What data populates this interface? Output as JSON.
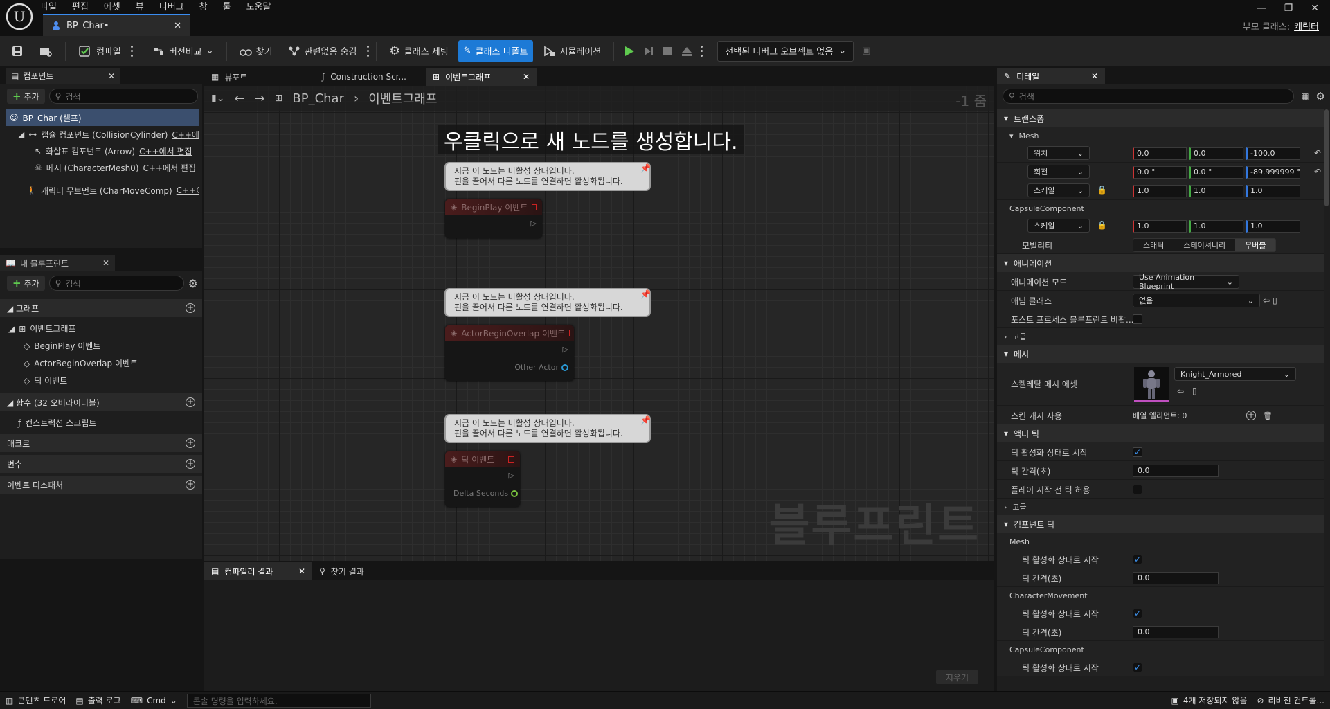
{
  "app": {
    "doc_tab": "BP_Char•",
    "parent_class_label": "부모 클래스:",
    "parent_class_value": "캐릭터"
  },
  "menu": [
    "파일",
    "편집",
    "에셋",
    "뷰",
    "디버그",
    "창",
    "툴",
    "도움말"
  ],
  "toolbar": {
    "compile": "컴파일",
    "diff": "버전비교",
    "find": "찾기",
    "hide_unrelated": "관련없음 숨김",
    "class_settings": "클래스 세팅",
    "class_defaults": "클래스 디폴트",
    "simulation": "시뮬레이션",
    "debug_object": "선택된 디버그 오브젝트 없음"
  },
  "components": {
    "title": "컴포넌트",
    "add": "추가",
    "search_placeholder": "검색",
    "items": [
      {
        "label": "BP_Char (셀프)",
        "cpp": ""
      },
      {
        "label": "캡슐 컴포넌트 (CollisionCylinder)",
        "cpp": "C++에..."
      },
      {
        "label": "화살표 컴포넌트 (Arrow)",
        "cpp": "C++에서 편집"
      },
      {
        "label": "메시 (CharacterMesh0)",
        "cpp": "C++에서 편집"
      },
      {
        "label": "캐릭터 무브먼트 (CharMoveComp)",
        "cpp": "C++C"
      }
    ]
  },
  "my_blueprint": {
    "title": "내 블루프린트",
    "add": "추가",
    "search_placeholder": "검색",
    "graph_section": "그래프",
    "event_graph": "이벤트그래프",
    "events": [
      "BeginPlay 이벤트",
      "ActorBeginOverlap 이벤트",
      "틱 이벤트"
    ],
    "functions_section": "함수 (32 오버라이더블)",
    "construction_script": "컨스트럭션 스크립트",
    "macros": "매크로",
    "variables": "변수",
    "dispatchers": "이벤트 디스패처"
  },
  "graph": {
    "tabs": [
      "뷰포트",
      "Construction Scr...",
      "이벤트그래프"
    ],
    "breadcrumb_root": "BP_Char",
    "breadcrumb_current": "이벤트그래프",
    "zoom": "-1 줌",
    "hint": "우클릭으로 새 노드를 생성합니다.",
    "watermark": "블루프린트",
    "note_line1": "지금 이 노드는 비활성 상태입니다.",
    "note_line2": "핀을 끌어서 다른 노드를 연결하면 활성화됩니다.",
    "nodes": [
      {
        "title": "BeginPlay 이벤트",
        "pin": ""
      },
      {
        "title": "ActorBeginOverlap 이벤트",
        "pin": "Other Actor"
      },
      {
        "title": "틱 이벤트",
        "pin": "Delta Seconds"
      }
    ]
  },
  "output": {
    "compiler_results": "컴파일러 결과",
    "find_results": "찾기 결과",
    "clear": "지우기"
  },
  "details": {
    "title": "디테일",
    "search_placeholder": "검색",
    "transform": "트랜스폼",
    "mesh_sub": "Mesh",
    "location": "위치",
    "rotation": "회전",
    "scale": "스케일",
    "loc": [
      "0.0",
      "0.0",
      "-100.0"
    ],
    "rot": [
      "0.0 °",
      "0.0 °",
      "-89.999999 °"
    ],
    "scl": [
      "1.0",
      "1.0",
      "1.0"
    ],
    "capsule_sub": "CapsuleComponent",
    "capsule_scl": [
      "1.0",
      "1.0",
      "1.0"
    ],
    "mobility": "모빌리티",
    "mobility_opts": [
      "스태틱",
      "스테이셔너리",
      "무버블"
    ],
    "animation": "애니메이션",
    "anim_mode": "애니메이션 모드",
    "anim_mode_val": "Use Animation Blueprint",
    "anim_class": "애님 클래스",
    "anim_class_val": "없음",
    "post_process": "포스트 프로세스 블루프린트 비활...",
    "advanced": "고급",
    "mesh_section": "메시",
    "skeletal_mesh": "스켈레탈 메시 에셋",
    "skeletal_mesh_val": "Knight_Armored",
    "skin_cache": "스킨 캐시 사용",
    "array_elements": "배열 엘리먼트: 0",
    "actor_tick": "액터 틱",
    "tick_start": "틱 활성화 상태로 시작",
    "tick_interval": "틱 간격(초)",
    "tick_interval_val": "0.0",
    "tick_before_play": "플레이 시작 전 틱 허용",
    "component_tick": "컴포넌트 틱",
    "char_movement_sub": "CharacterMovement"
  },
  "status": {
    "content_drawer": "콘텐츠 드로어",
    "output_log": "출력 로그",
    "cmd": "Cmd",
    "console_placeholder": "콘솔 명령을 입력하세요.",
    "unsaved": "4개 저장되지 않음",
    "revision": "리비전 컨트롤..."
  }
}
